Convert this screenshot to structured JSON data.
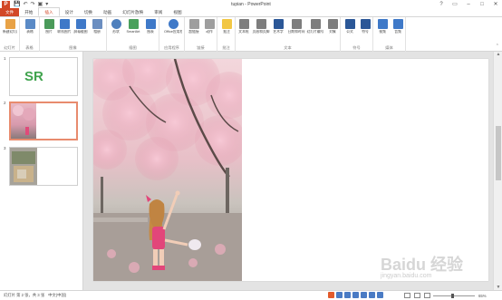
{
  "window": {
    "title": "tupian - PowerPoint",
    "controls": [
      "?",
      "▭",
      "–",
      "□",
      "✕"
    ]
  },
  "quick_access": [
    "💾",
    "↶",
    "↷",
    "▣",
    "▾"
  ],
  "tabs": [
    {
      "label": "文件"
    },
    {
      "label": "开始"
    },
    {
      "label": "插入"
    },
    {
      "label": "设计"
    },
    {
      "label": "切换"
    },
    {
      "label": "动画"
    },
    {
      "label": "幻灯片放映"
    },
    {
      "label": "审阅"
    },
    {
      "label": "视图"
    }
  ],
  "active_tab": "插入",
  "user": "李铭 ▾",
  "ribbon": {
    "groups": [
      {
        "label": "幻灯片",
        "buttons": [
          {
            "label": "新建幻灯片",
            "color": "#e8a246"
          }
        ]
      },
      {
        "label": "表格",
        "buttons": [
          {
            "label": "表格",
            "color": "#5a8ac6"
          }
        ]
      },
      {
        "label": "图像",
        "buttons": [
          {
            "label": "图片",
            "color": "#4a9a5a"
          },
          {
            "label": "联机图片",
            "color": "#3f79c8"
          },
          {
            "label": "屏幕截图",
            "color": "#3f79c8"
          },
          {
            "label": "相册",
            "color": "#6b8ec0"
          }
        ]
      },
      {
        "label": "插图",
        "buttons": [
          {
            "label": "形状",
            "color": "#4f80bd"
          },
          {
            "label": "SmartArt",
            "color": "#4aa05c"
          },
          {
            "label": "图表",
            "color": "#3f79c8"
          }
        ]
      },
      {
        "label": "应用程序",
        "buttons": [
          {
            "label": "Office应用程序",
            "color": "#3f79c8"
          }
        ]
      },
      {
        "label": "链接",
        "buttons": [
          {
            "label": "超链接",
            "color": "#9e9e9e"
          },
          {
            "label": "动作",
            "color": "#9e9e9e"
          }
        ]
      },
      {
        "label": "批注",
        "buttons": [
          {
            "label": "批注",
            "color": "#f2c744"
          }
        ]
      },
      {
        "label": "文本",
        "buttons": [
          {
            "label": "文本框",
            "color": "#7d7d7d"
          },
          {
            "label": "页眉和页脚",
            "color": "#7d7d7d"
          },
          {
            "label": "艺术字",
            "color": "#2b5797"
          },
          {
            "label": "日期和时间",
            "color": "#7d7d7d"
          },
          {
            "label": "幻灯片编号",
            "color": "#7d7d7d"
          },
          {
            "label": "对象",
            "color": "#7d7d7d"
          }
        ]
      },
      {
        "label": "符号",
        "buttons": [
          {
            "label": "公式",
            "color": "#2b5797"
          },
          {
            "label": "符号",
            "color": "#2b5797"
          }
        ]
      },
      {
        "label": "媒体",
        "buttons": [
          {
            "label": "视频",
            "color": "#3f79c8"
          },
          {
            "label": "音频",
            "color": "#3f79c8"
          }
        ]
      }
    ]
  },
  "slides": [
    {
      "number": "1"
    },
    {
      "number": "2"
    },
    {
      "number": "3"
    }
  ],
  "selected_slide": 2,
  "logo_text": "SR",
  "status": {
    "slide_info": "幻灯片 第 2 张，共 3 张",
    "language": "中文(中国)",
    "zoom": "65%"
  },
  "watermark": {
    "text": "Baidu 经验",
    "sub": "jingyan.baidu.com"
  },
  "colors": {
    "accent": "#d24726",
    "selected_border": "#e88b6e",
    "logo_green": "#3fa34d"
  }
}
